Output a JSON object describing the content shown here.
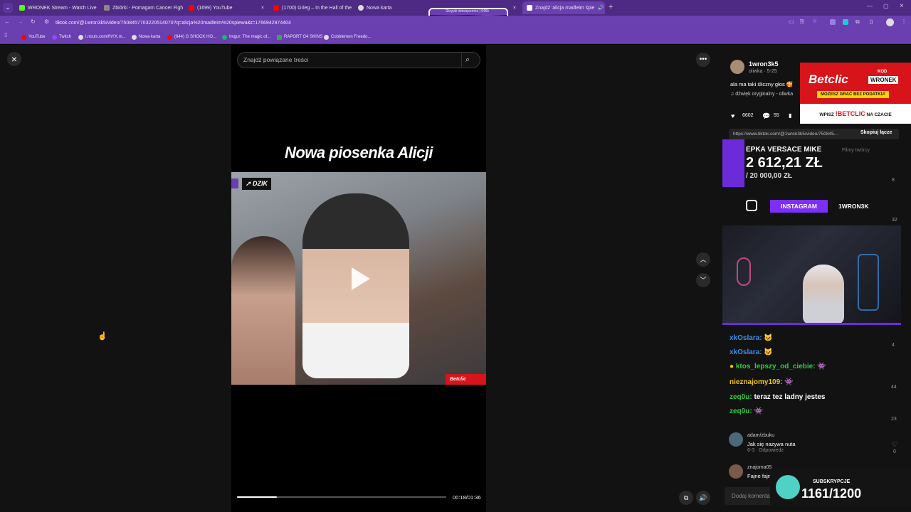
{
  "browser": {
    "tabs": [
      {
        "label": "WRONEK Stream - Watch Live",
        "color": "#53fc18"
      },
      {
        "label": "Zbiórki - Pomagam Cancer Figh",
        "color": "#888888"
      },
      {
        "label": "(1699) YouTube",
        "color": "#ff0000"
      },
      {
        "label": "(1700) Grieg – In the Hall of the",
        "color": "#ff0000"
      },
      {
        "label": "Nowa karta",
        "color": "#dddddd"
      },
      {
        "label": "Skrypki dziwięczenia | 645k",
        "color": "#b9a6d9"
      },
      {
        "label": "Znajdź 'alicja madleim śpie",
        "color": "#ffffff"
      }
    ],
    "address": "tiktok.com/@1wron3k5/video/7508457703220514070?q=alicja%20madleim%20spiewa&t=1766942974404",
    "bookmarks": [
      {
        "label": "YouTube",
        "color": "#ff0000"
      },
      {
        "label": "Twitch",
        "color": "#9146ff"
      },
      {
        "label": "i.nouls.com/fhYX.m...",
        "color": "#dddddd"
      },
      {
        "label": "Nowa karta",
        "color": "#dddddd"
      },
      {
        "label": "(644) G SHOCK HO...",
        "color": "#ff0000"
      },
      {
        "label": "Imgur: The magic of...",
        "color": "#1bb76e"
      },
      {
        "label": "RAPORT G4 SKINS",
        "color": "#34a853"
      },
      {
        "label": "Cobblemon Freedo...",
        "color": "#dddddd"
      }
    ]
  },
  "video": {
    "search_placeholder": "Znajdź powiązane treści",
    "title": "Nowa piosenka Alicji",
    "badge": "DZIK",
    "brand_tag": "Betclic",
    "time": "00:18/01:36",
    "progress": 0.19
  },
  "post": {
    "username": "1wron3k5",
    "sub": "oliwka · 5-25",
    "caption": "ala ma taki śliczny głos 🥰",
    "sound": "♫ dźwięk oryginalny - oliwka",
    "likes": "6602",
    "comments": "55",
    "link": "https://www.tiktok.com/@1wron3k5/video/750845...",
    "copy_link": "Skopiuj łącze",
    "creator_videos": "Filmy twórcy"
  },
  "betclic": {
    "logo": "Betclic",
    "kod": "KOD",
    "code": "WRONEK",
    "promo": "MOZESZ GRAĆ BEZ PODATKU!",
    "footer_a": "WPISZ",
    "footer_b": "!BETCLIC",
    "footer_c": "NA CZACIE"
  },
  "donation": {
    "name": "EPKA VERSACE MIKE",
    "amount": "2 612,21 ZŁ",
    "goal": "/ 20 000,00 ZŁ"
  },
  "instagram": {
    "label": "INSTAGRAM",
    "handle": "1WRON3K"
  },
  "chat": [
    {
      "user": "xkOslara:",
      "color": "#3a8ee6"
    },
    {
      "user": "xkOslara:",
      "color": "#3a8ee6"
    },
    {
      "user": "ktos_lepszy_od_ciebie:",
      "color": "#2ecc40"
    },
    {
      "user": "nieznajomy109:",
      "color": "#f0c419"
    },
    {
      "user": "zeq0u:",
      "color": "#2ecc40",
      "text": "teraz tez ladny jestes"
    },
    {
      "user": "zeq0u:",
      "color": "#2ecc40"
    }
  ],
  "comments_list": [
    {
      "user": "adam/zbuku",
      "text": "Jak się nazywa nuta",
      "meta": "6-3",
      "reply": "Odpowiedz",
      "count": "0"
    },
    {
      "user": "znajoma05",
      "text": "Fajne fajne",
      "count": ""
    }
  ],
  "side_counts": [
    "8",
    "32",
    "4",
    "44",
    "23"
  ],
  "add_comment": "Dodaj komentarz...",
  "subs": {
    "label": "SUBSKRYPCJE",
    "value": "1161/1200"
  }
}
